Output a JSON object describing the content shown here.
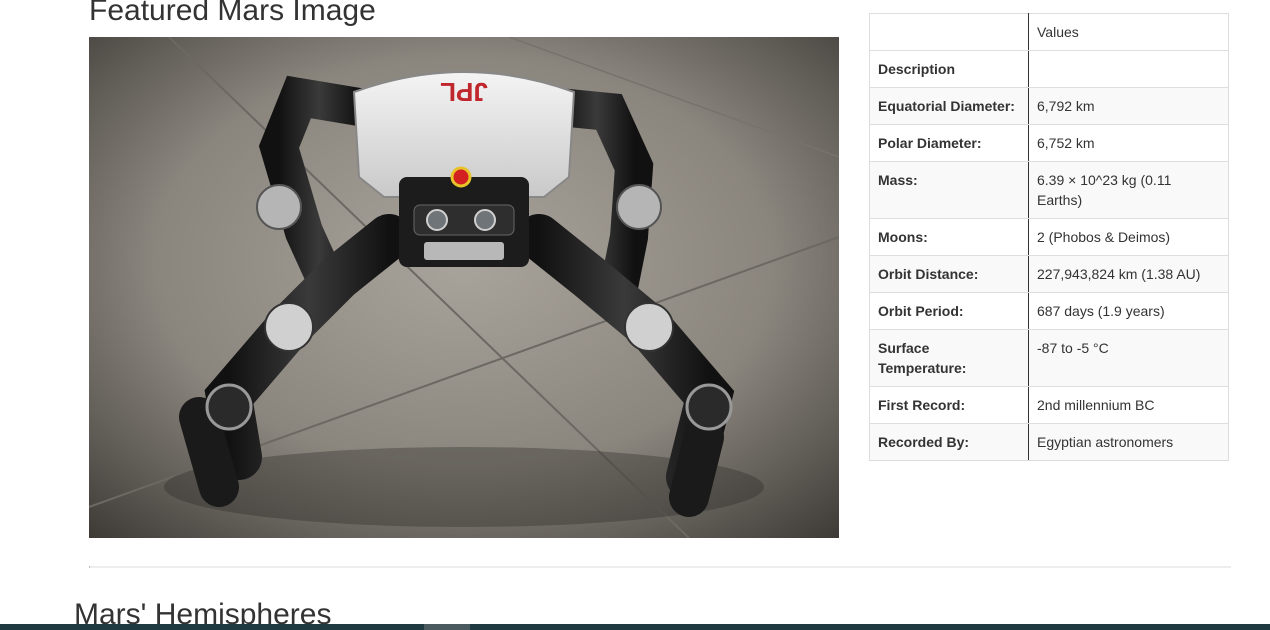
{
  "featured": {
    "title": "Featured Mars Image",
    "image_alt": "JPL four-limbed robot standing on a concrete floor",
    "robot_logo_text": "JPL"
  },
  "facts": {
    "header": {
      "label": "",
      "value": "Values"
    },
    "rows": [
      {
        "label": "Description",
        "value": ""
      },
      {
        "label": "Equatorial Diameter:",
        "value": "6,792 km"
      },
      {
        "label": "Polar Diameter:",
        "value": "6,752 km"
      },
      {
        "label": "Mass:",
        "value": "6.39 × 10^23 kg (0.11 Earths)"
      },
      {
        "label": "Moons:",
        "value": "2 (Phobos & Deimos)"
      },
      {
        "label": "Orbit Distance:",
        "value": "227,943,824 km (1.38 AU)"
      },
      {
        "label": "Orbit Period:",
        "value": "687 days (1.9 years)"
      },
      {
        "label": "Surface Temperature:",
        "value": "-87 to -5 °C"
      },
      {
        "label": "First Record:",
        "value": "2nd millennium BC"
      },
      {
        "label": "Recorded By:",
        "value": "Egyptian astronomers"
      }
    ]
  },
  "hemispheres": {
    "title": "Mars' Hemispheres"
  },
  "colors": {
    "text": "#333333",
    "table_border": "#333333",
    "row_stripe": "#f9f9f9",
    "bottom_bar": "#1f3a40"
  }
}
